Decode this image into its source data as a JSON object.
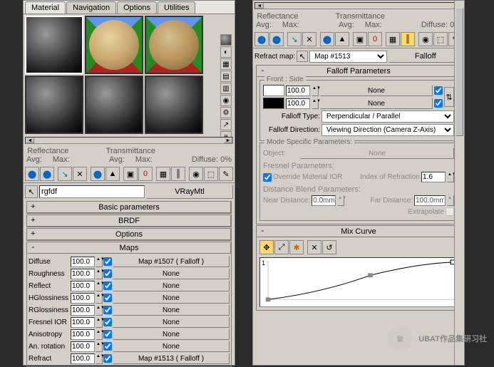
{
  "tabs": [
    "Material",
    "Navigation",
    "Options",
    "Utilities"
  ],
  "stats": {
    "reflectance": "Reflectance",
    "transmittance": "Transmittance",
    "avg": "Avg:",
    "max": "Max:",
    "diffuse": "Diffuse:",
    "diffuseVal": "0%"
  },
  "matName": "rgfdf",
  "matType": "VRayMtl",
  "rollups": {
    "basic": "Basic parameters",
    "brdf": "BRDF",
    "options": "Options",
    "maps": "Maps",
    "falloff": "Falloff Parameters",
    "modespec": "Mode Specific Parameters:",
    "mixcurve": "Mix Curve"
  },
  "maps": [
    {
      "name": "Diffuse",
      "val": "100.0",
      "map": "Map #1507 ( Falloff )"
    },
    {
      "name": "Roughness",
      "val": "100.0",
      "map": "None"
    },
    {
      "name": "Reflect",
      "val": "100.0",
      "map": "None"
    },
    {
      "name": "HGlossiness",
      "val": "100.0",
      "map": "None"
    },
    {
      "name": "RGlossiness",
      "val": "100.0",
      "map": "None"
    },
    {
      "name": "Fresnel IOR",
      "val": "100.0",
      "map": "None"
    },
    {
      "name": "Anisotropy",
      "val": "100.0",
      "map": "None"
    },
    {
      "name": "An. rotation",
      "val": "100.0",
      "map": "None"
    },
    {
      "name": "Refract",
      "val": "100.0",
      "map": "Map #1513 ( Falloff )"
    }
  ],
  "refract": {
    "label": "Refract map:",
    "mapName": "Map #1513",
    "btn": "Falloff"
  },
  "falloff": {
    "frontside": "Front : Side",
    "v1": "100.0",
    "v2": "100.0",
    "none": "None",
    "typeLbl": "Falloff Type:",
    "typeVal": "Perpendicular / Parallel",
    "dirLbl": "Falloff Direction:",
    "dirVal": "Viewing Direction (Camera Z-Axis)"
  },
  "modespec": {
    "object": "Object:",
    "none": "None",
    "fresnel": "Fresnel Parameters:",
    "override": "Override Material IOR",
    "iorLbl": "Index of Refraction",
    "iorVal": "1.6",
    "distblend": "Distance Blend Parameters:",
    "nearLbl": "Near Distance:",
    "nearVal": "0.0mm",
    "farLbl": "Far Distance:",
    "farVal": "100.0mm",
    "extrapolate": "Extrapolate"
  },
  "watermark": "UBAT作品集研习社"
}
